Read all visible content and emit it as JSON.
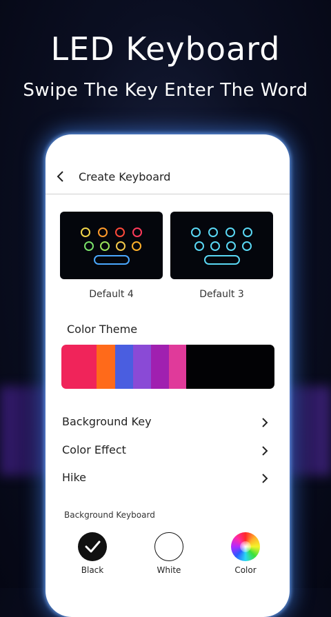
{
  "hero": {
    "title": "LED Keyboard",
    "subtitle": "Swipe The Key Enter The Word"
  },
  "header": {
    "back_icon": "chevron-left-icon",
    "title": "Create Keyboard"
  },
  "previews": [
    {
      "label": "Default 4",
      "ring_colors": [
        "#f2d64a",
        "#ff9a2a",
        "#ff4a3a",
        "#ff3a5a",
        "#7ae36a",
        "#9be35a",
        "#f4c94a",
        "#ffb02a"
      ],
      "bar_color": "#4aa8ff"
    },
    {
      "label": "Default 3",
      "ring_colors": [
        "#5ad8f4",
        "#5ad8f4",
        "#5ad8f4",
        "#5ad8f4",
        "#5ad8f4",
        "#5ad8f4",
        "#5ad8f4",
        "#5ad8f4"
      ],
      "bar_color": "#5ad8f4"
    }
  ],
  "color_theme": {
    "title": "Color Theme",
    "swatches": [
      "#f0245a",
      "#ff6a1a",
      "#4a5ee0",
      "#8a4ad6",
      "#a020b0",
      "#e03a9a",
      "#020205"
    ]
  },
  "menu": [
    {
      "label": "Background Key",
      "icon": "chevron-right-icon"
    },
    {
      "label": "Color Effect",
      "icon": "chevron-right-icon"
    },
    {
      "label": "Hike",
      "icon": "chevron-right-icon"
    }
  ],
  "background_keyboard": {
    "title": "Background Keyboard",
    "options": [
      {
        "label": "Black",
        "icon": "check-icon",
        "selected": true
      },
      {
        "label": "White"
      },
      {
        "label": "Color",
        "icon": "color-wheel-icon"
      }
    ]
  }
}
